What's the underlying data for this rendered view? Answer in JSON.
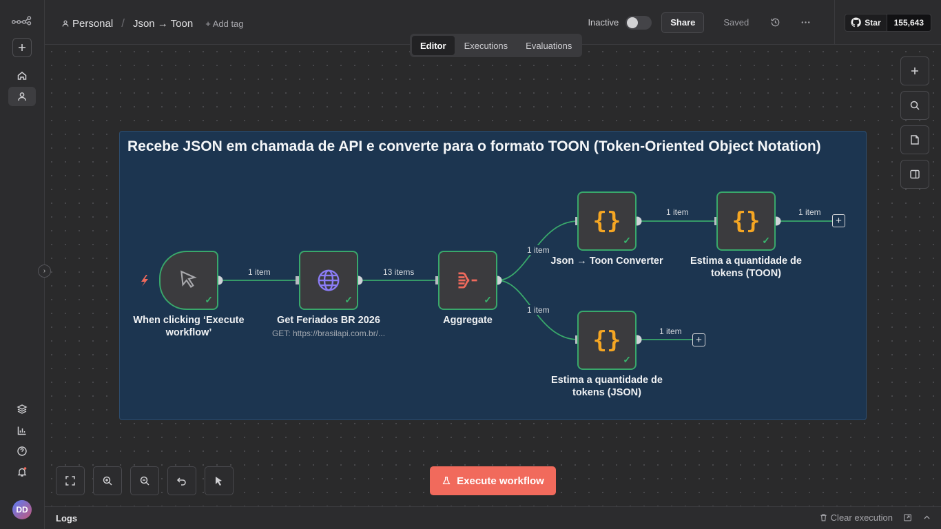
{
  "header": {
    "project": "Personal",
    "workflow_name": "Json → Toon",
    "add_tag": "+ Add tag",
    "status_label": "Inactive",
    "share_label": "Share",
    "saved_label": "Saved",
    "github_star_label": "Star",
    "github_star_count": "155,643"
  },
  "tabs": [
    {
      "label": "Editor",
      "active": true
    },
    {
      "label": "Executions",
      "active": false
    },
    {
      "label": "Evaluations",
      "active": false
    }
  ],
  "sticky_note": {
    "title": "Recebe JSON em chamada de API e converte para o formato TOON (Token-Oriented Object Notation)",
    "color": "#1c3550"
  },
  "nodes": [
    {
      "id": "trigger",
      "label_line1": "When clicking ‘Execute",
      "label_line2": "workflow’",
      "icon": "cursor-icon"
    },
    {
      "id": "http",
      "label_line1": "Get Feriados BR 2026",
      "subtitle": "GET: https://brasilapi.com.br/...",
      "icon": "globe-icon"
    },
    {
      "id": "aggregate",
      "label_line1": "Aggregate",
      "icon": "aggregate-icon"
    },
    {
      "id": "converter",
      "label_line1": "Json → Toon Converter",
      "icon": "code-braces-icon"
    },
    {
      "id": "tokens_toon",
      "label_line1": "Estima a quantidade de",
      "label_line2": "tokens (TOON)",
      "icon": "code-braces-icon"
    },
    {
      "id": "tokens_json",
      "label_line1": "Estima a quantidade de",
      "label_line2": "tokens (JSON)",
      "icon": "code-braces-icon"
    }
  ],
  "edges": [
    {
      "from": "trigger",
      "to": "http",
      "label": "1 item"
    },
    {
      "from": "http",
      "to": "aggregate",
      "label": "13 items"
    },
    {
      "from": "aggregate",
      "to": "converter",
      "label": "1 item"
    },
    {
      "from": "aggregate",
      "to": "tokens_json",
      "label": "1 item"
    },
    {
      "from": "converter",
      "to": "tokens_toon",
      "label": "1 item"
    },
    {
      "from": "tokens_toon",
      "to": "end",
      "label": "1 item"
    },
    {
      "from": "tokens_json",
      "to": "end",
      "label": "1 item"
    }
  ],
  "execute_button": "Execute workflow",
  "logs": {
    "title": "Logs",
    "clear_label": "Clear execution"
  },
  "user": {
    "initials": "DD"
  },
  "colors": {
    "accent": "#f16a5c",
    "success": "#39a86b",
    "code_icon": "#f5a623",
    "globe_icon": "#8b7cf6"
  }
}
